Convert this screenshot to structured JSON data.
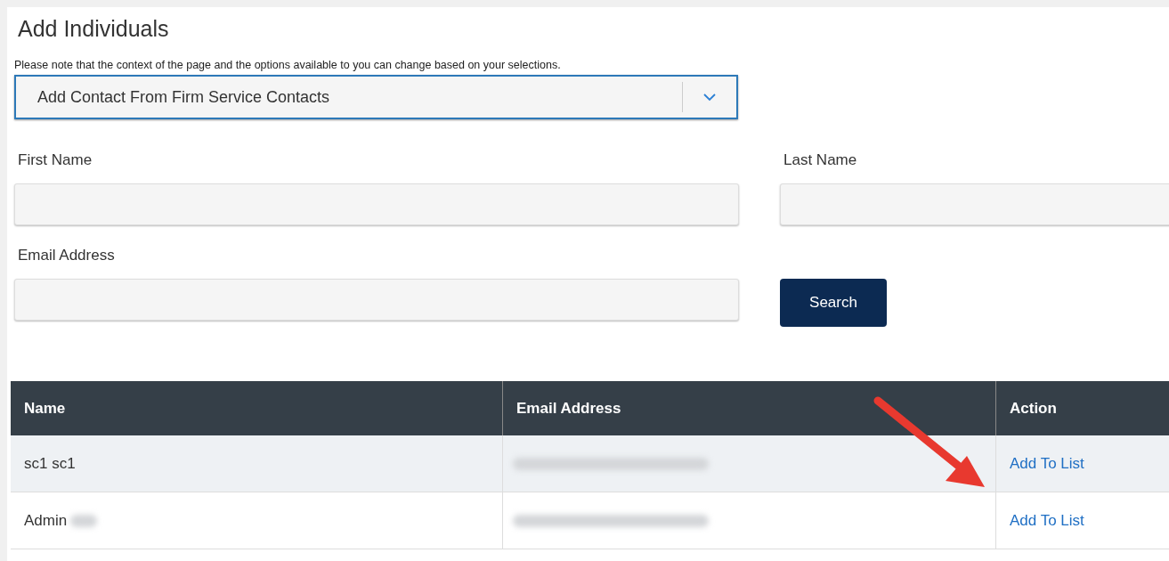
{
  "title": "Add Individuals",
  "note": "Please note that the context of the page and the options available to you can change based on your selections.",
  "source_select": {
    "value": "Add Contact From Firm Service Contacts"
  },
  "fields": [
    {
      "label": "First Name"
    },
    {
      "label": "Last Name"
    },
    {
      "label": "Email Address"
    }
  ],
  "search_button": "Search",
  "table": {
    "columns": [
      "Name",
      "Email Address",
      "Action"
    ],
    "rows": [
      {
        "name": "sc1 sc1",
        "name_redacted": false,
        "email_redacted": true,
        "action": "Add To List",
        "highlighted": true
      },
      {
        "name": "Admin",
        "name_redacted": true,
        "email_redacted": true,
        "action": "Add To List",
        "highlighted": false
      }
    ]
  },
  "annotation": {
    "kind": "arrow"
  }
}
